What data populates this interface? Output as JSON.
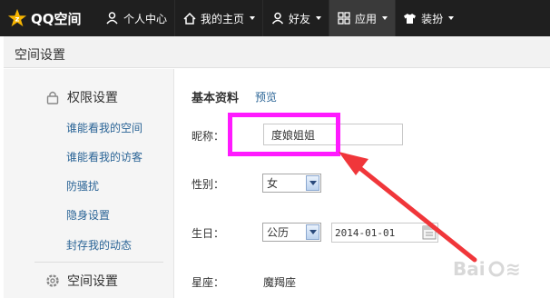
{
  "topbar": {
    "logo_text": "QQ空间",
    "items": [
      {
        "label": "个人中心",
        "icon": "person-icon"
      },
      {
        "label": "我的主页",
        "icon": "home-icon"
      },
      {
        "label": "好友",
        "icon": "friends-icon"
      },
      {
        "label": "应用",
        "icon": "apps-grid-icon"
      },
      {
        "label": "装扮",
        "icon": "shirt-icon"
      }
    ]
  },
  "page_title": "空间设置",
  "sidebar": {
    "section1_title": "权限设置",
    "links": [
      "谁能看我的空间",
      "谁能看我的访客",
      "防骚扰",
      "隐身设置",
      "封存我的动态"
    ],
    "section2_title": "空间设置"
  },
  "main": {
    "heading": "基本资料",
    "preview_link": "预览",
    "nickname_label": "昵称：",
    "nickname_value": "度娘姐姐",
    "gender_label": "性别：",
    "gender_value": "女",
    "birthday_label": "生日：",
    "calendar_type": "公历",
    "birthday_value": "2014-01-01",
    "zodiac_label": "星座：",
    "zodiac_value": "魔羯座"
  },
  "colors": {
    "highlight": "#ff1aff",
    "annotation_arrow": "#f0363a",
    "link": "#2a6496",
    "topbar": "#1f1f1f"
  }
}
